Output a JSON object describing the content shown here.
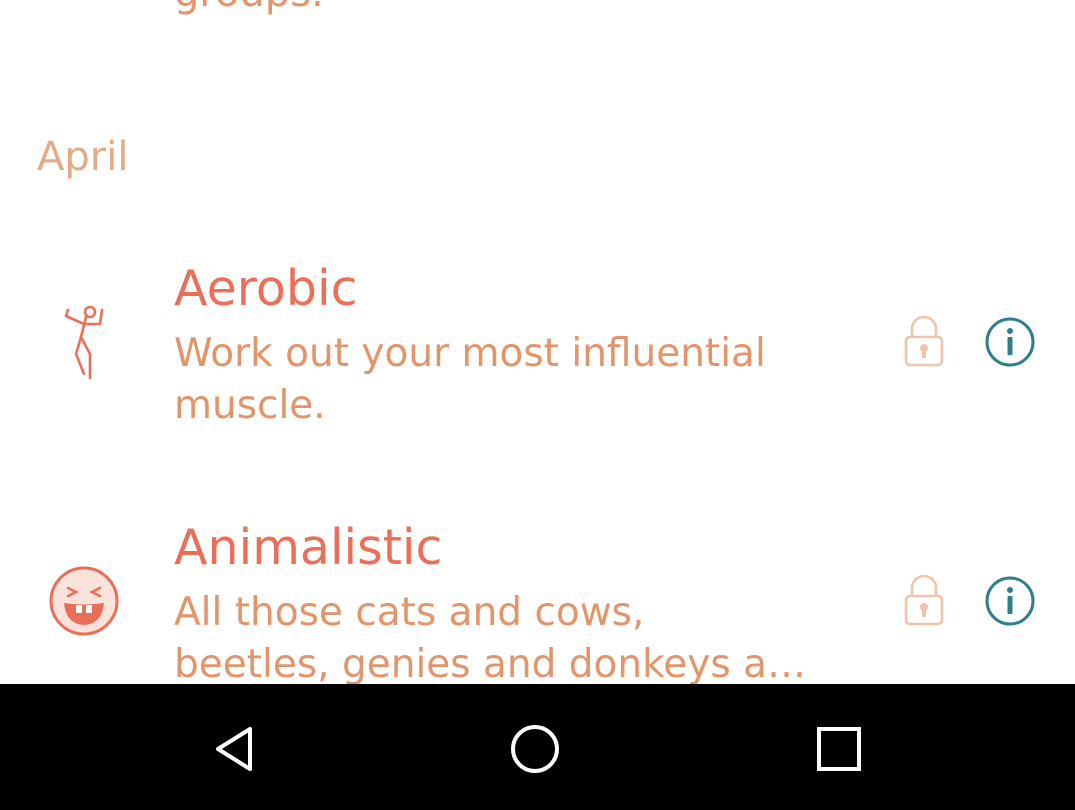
{
  "list": {
    "top_cut_text": "groups.",
    "section_month": "April",
    "items": [
      {
        "title": "Aerobic",
        "description_line1": "Work out your most influential",
        "description_line2": "muscle.",
        "icon": "dancing-person-icon",
        "locked": true
      },
      {
        "title": "Animalistic",
        "description_line1": "All those cats and cows,",
        "description_line2": "beetles, genies and donkeys a…",
        "icon": "laughing-face-icon",
        "locked": true
      }
    ]
  },
  "navigation_bar": {
    "back": "back-triangle-icon",
    "home": "home-circle-icon",
    "recents": "recents-square-icon"
  },
  "colors": {
    "title": "#ea6f58",
    "description": "#e2956a",
    "month": "#e4aa86",
    "lock": "#f0c4a8",
    "info": "#2e7f87",
    "navbar": "#000000"
  }
}
